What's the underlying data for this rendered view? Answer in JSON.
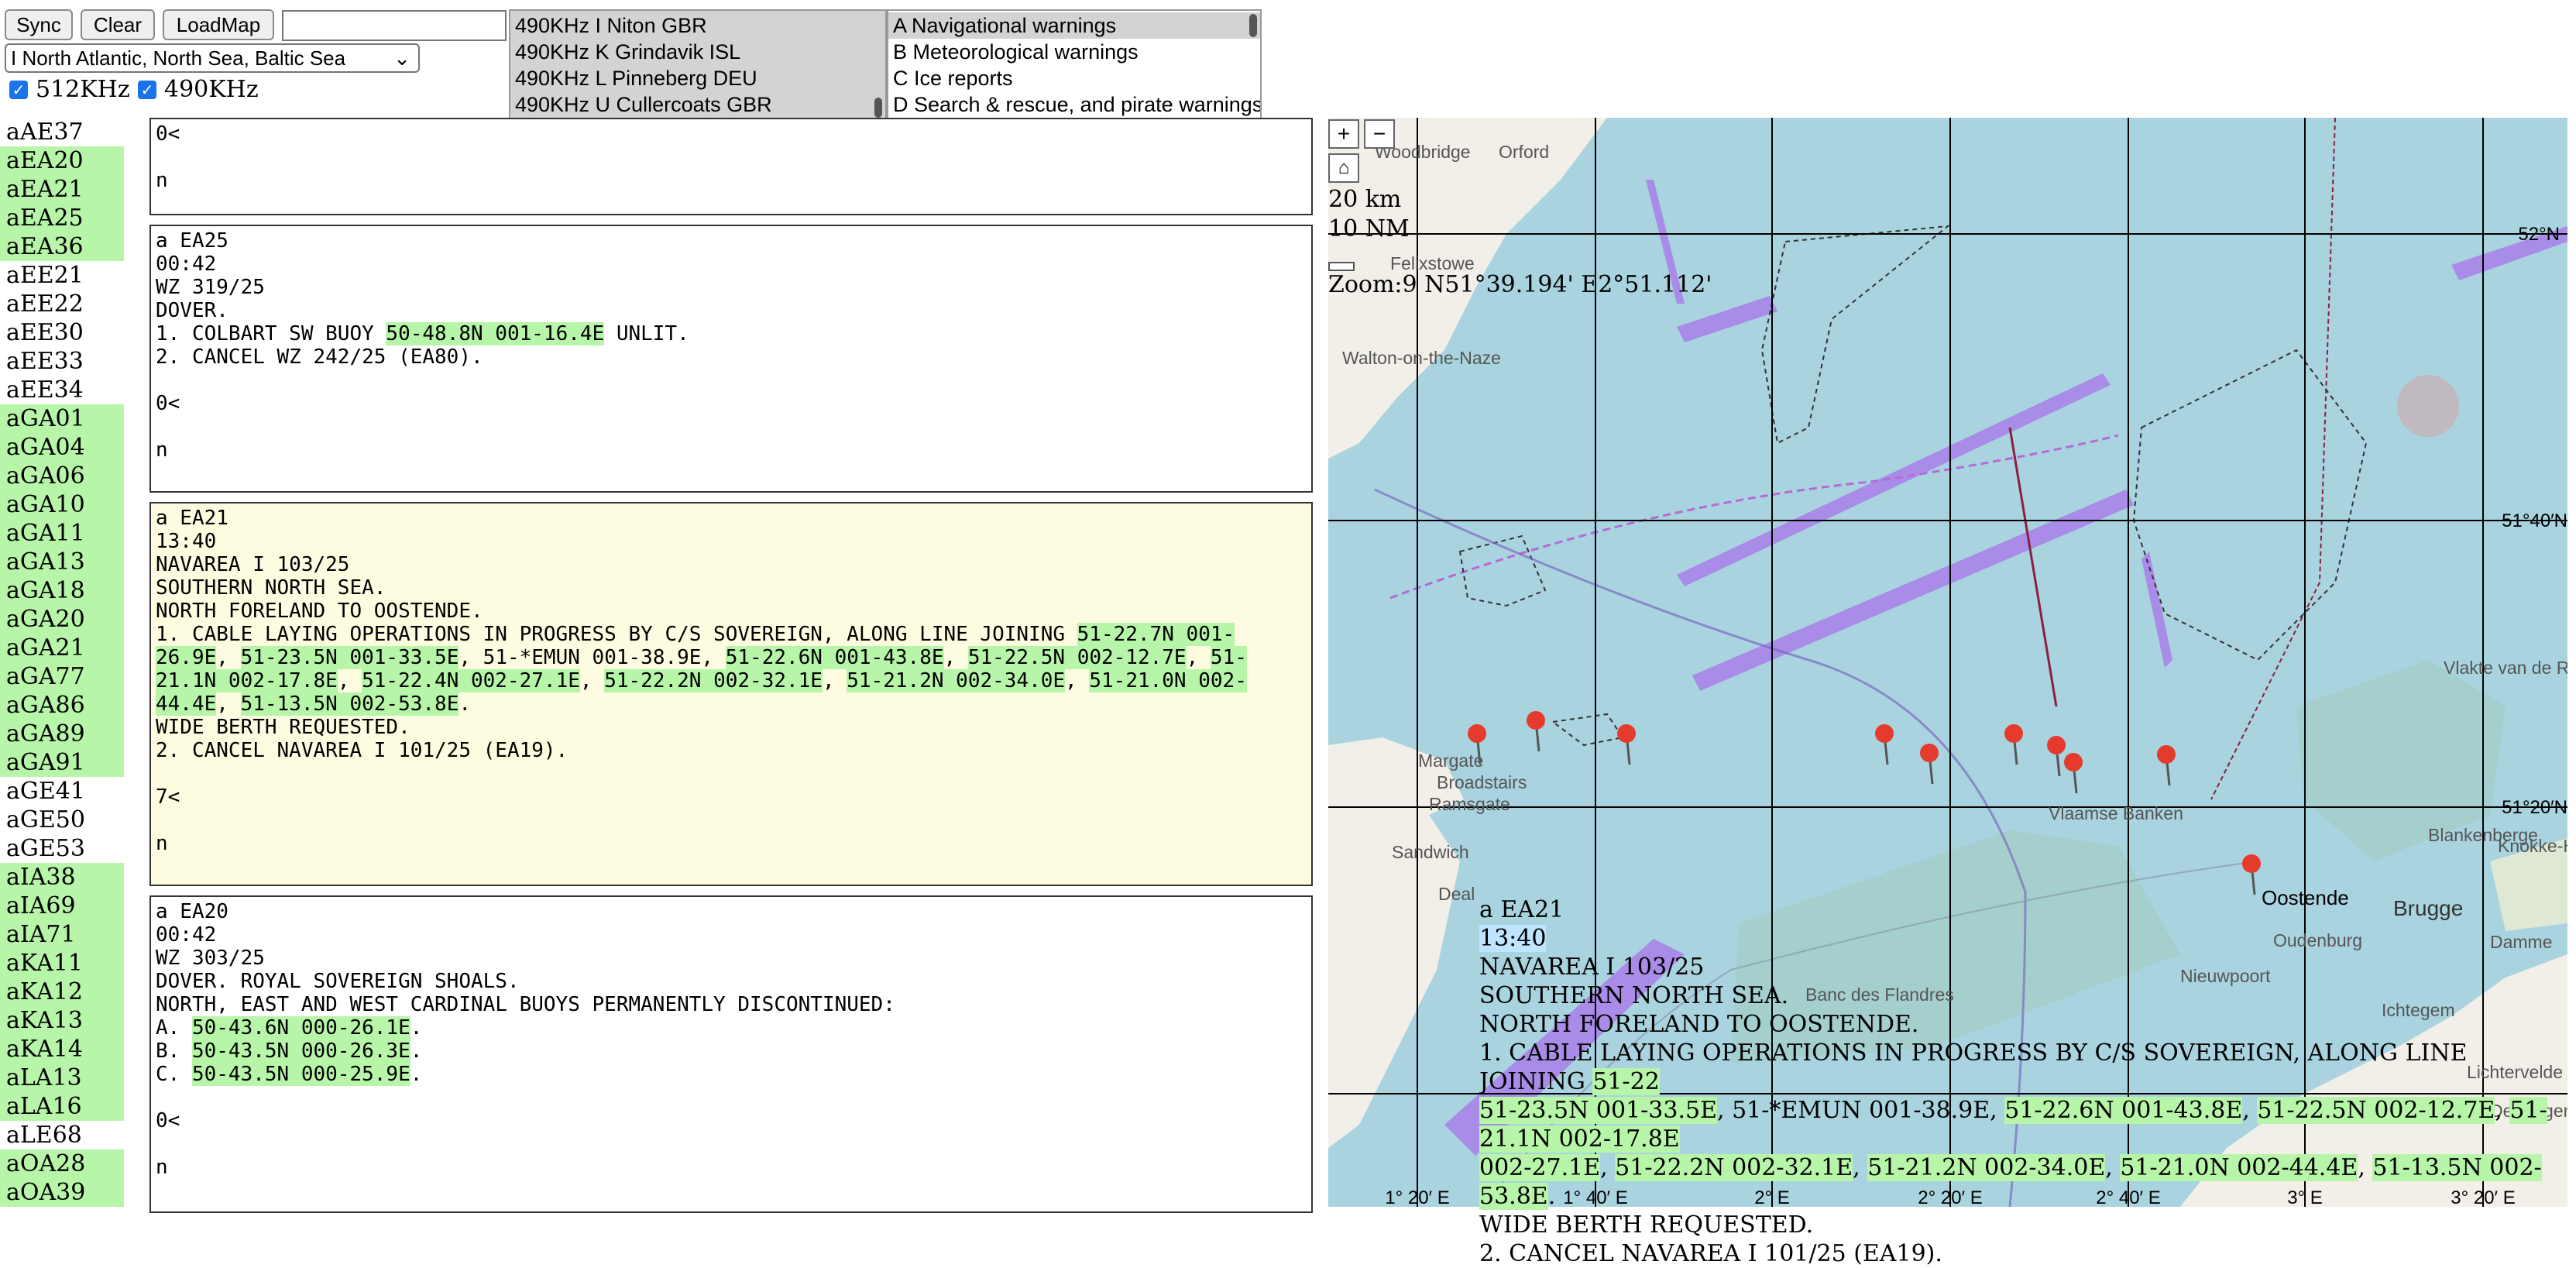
{
  "toolbar": {
    "sync_label": "Sync",
    "clear_label": "Clear",
    "loadmap_label": "LoadMap",
    "search_value": "",
    "region_selected": "I North Atlantic, North Sea, Baltic Sea",
    "chk_512_label": "512KHz",
    "chk_490_label": "490KHz"
  },
  "stations": [
    "490KHz I Niton GBR",
    "490KHz K Grindavik ISL",
    "490KHz L Pinneberg DEU",
    "490KHz U Cullercoats GBR"
  ],
  "categories": [
    "A Navigational warnings",
    "B Meteorological warnings",
    "C Ice reports",
    "D Search & rescue, and pirate warnings"
  ],
  "sidebar": [
    {
      "id": "aAE37",
      "hl": false
    },
    {
      "id": "aEA20",
      "hl": true
    },
    {
      "id": "aEA21",
      "hl": true
    },
    {
      "id": "aEA25",
      "hl": true
    },
    {
      "id": "aEA36",
      "hl": true
    },
    {
      "id": "aEE21",
      "hl": false
    },
    {
      "id": "aEE22",
      "hl": false
    },
    {
      "id": "aEE30",
      "hl": false
    },
    {
      "id": "aEE33",
      "hl": false
    },
    {
      "id": "aEE34",
      "hl": false
    },
    {
      "id": "aGA01",
      "hl": true
    },
    {
      "id": "aGA04",
      "hl": true
    },
    {
      "id": "aGA06",
      "hl": true
    },
    {
      "id": "aGA10",
      "hl": true
    },
    {
      "id": "aGA11",
      "hl": true
    },
    {
      "id": "aGA13",
      "hl": true
    },
    {
      "id": "aGA18",
      "hl": true
    },
    {
      "id": "aGA20",
      "hl": true
    },
    {
      "id": "aGA21",
      "hl": true
    },
    {
      "id": "aGA77",
      "hl": true
    },
    {
      "id": "aGA86",
      "hl": true
    },
    {
      "id": "aGA89",
      "hl": true
    },
    {
      "id": "aGA91",
      "hl": true
    },
    {
      "id": "aGE41",
      "hl": false
    },
    {
      "id": "aGE50",
      "hl": false
    },
    {
      "id": "aGE53",
      "hl": false
    },
    {
      "id": "aIA38",
      "hl": true
    },
    {
      "id": "aIA69",
      "hl": true
    },
    {
      "id": "aIA71",
      "hl": true
    },
    {
      "id": "aKA11",
      "hl": true
    },
    {
      "id": "aKA12",
      "hl": true
    },
    {
      "id": "aKA13",
      "hl": true
    },
    {
      "id": "aKA14",
      "hl": true
    },
    {
      "id": "aLA13",
      "hl": true
    },
    {
      "id": "aLA16",
      "hl": true
    },
    {
      "id": "aLE68",
      "hl": false
    },
    {
      "id": "aOA28",
      "hl": true
    },
    {
      "id": "aOA39",
      "hl": true
    }
  ],
  "messages": [
    {
      "bg": "#ffffff",
      "segments": [
        [
          "0<\n\nn",
          false
        ]
      ]
    },
    {
      "bg": "#ffffff",
      "segments": [
        [
          "a EA25\n00:42\nWZ 319/25\nDOVER.\n1. COLBART SW BUOY ",
          false
        ],
        [
          "50-48.8N 001-16.4E",
          true
        ],
        [
          " UNLIT.\n2. CANCEL WZ 242/25 (EA80).\n\n0<\n\nn",
          false
        ]
      ]
    },
    {
      "bg": "#fefce0",
      "segments": [
        [
          "a EA21\n13:40\nNAVAREA I 103/25\nSOUTHERN NORTH SEA.\nNORTH FORELAND TO OOSTENDE.\n1. CABLE LAYING OPERATIONS IN PROGRESS BY C/S SOVEREIGN, ALONG LINE JOINING ",
          false
        ],
        [
          "51-22.7N 001-26.9E",
          true
        ],
        [
          ", ",
          false
        ],
        [
          "51-23.5N 001-33.5E",
          true
        ],
        [
          ", 51-*EMUN 001-38.9E, ",
          false
        ],
        [
          "51-22.6N 001-43.8E",
          true
        ],
        [
          ", ",
          false
        ],
        [
          "51-22.5N 002-12.7E",
          true
        ],
        [
          ", ",
          false
        ],
        [
          "51-21.1N 002-17.8E",
          true
        ],
        [
          ", ",
          false
        ],
        [
          "51-22.4N 002-27.1E",
          true
        ],
        [
          ", ",
          false
        ],
        [
          "51-22.2N 002-32.1E",
          true
        ],
        [
          ", ",
          false
        ],
        [
          "51-21.2N 002-34.0E",
          true
        ],
        [
          ", ",
          false
        ],
        [
          "51-21.0N 002-44.4E",
          true
        ],
        [
          ", ",
          false
        ],
        [
          "51-13.5N 002-53.8E",
          true
        ],
        [
          ".\nWIDE BERTH REQUESTED.\n2. CANCEL NAVAREA I 101/25 (EA19).\n\n7<\n\nn",
          false
        ]
      ]
    },
    {
      "bg": "#ffffff",
      "segments": [
        [
          "a EA20\n00:42\nWZ 303/25\nDOVER. ROYAL SOVEREIGN SHOALS.\nNORTH, EAST AND WEST CARDINAL BUOYS PERMANENTLY DISCONTINUED:\nA. ",
          false
        ],
        [
          "50-43.6N 000-26.1E",
          true
        ],
        [
          ".\nB. ",
          false
        ],
        [
          "50-43.5N 000-26.3E",
          true
        ],
        [
          ".\nC. ",
          false
        ],
        [
          "50-43.5N 000-25.9E",
          true
        ],
        [
          ".\n\n0<\n\nn",
          false
        ]
      ]
    }
  ],
  "map": {
    "zoom_in": "+",
    "zoom_out": "−",
    "home_icon": "home-icon",
    "scale_km": "20 km",
    "scale_nm": "10 NM",
    "status": "Zoom:9 N51°39.194' E2°51.112'",
    "lat_labels": [
      "52°N",
      "51°40′N",
      "51°20′N"
    ],
    "lon_labels": [
      "1° 20′ E",
      "1° 40′ E",
      "2° E",
      "2° 20′ E",
      "2° 40′ E",
      "3° E",
      "3° 20′ E"
    ],
    "places": [
      "Woodbridge",
      "Orford",
      "Felixstowe",
      "Walton-on-the-Naze",
      "Margate",
      "Broadstairs",
      "Ramsgate",
      "Sandwich",
      "Deal",
      "Vlaamse Banken",
      "Banc des Flandres",
      "Vlakte van de Raan",
      "Blankenberge",
      "Oostende",
      "Brugge",
      "Oudenburg",
      "Nieuwpoort",
      "Damme",
      "Knokke-Heist",
      "Dentergem",
      "Ichtegem",
      "Lichtervelde"
    ],
    "popup": [
      [
        "a EA21\n",
        false,
        false
      ],
      [
        "13:40",
        false,
        true
      ],
      [
        "\nNAVAREA I 103/25\nSOUTHERN NORTH SEA.\nNORTH FORELAND TO OOSTENDE.\n1. CABLE LAYING OPERATIONS IN PROGRESS BY C/S SOVEREIGN, ALONG LINE JOINING ",
        false,
        false
      ],
      [
        "51-22",
        true,
        false
      ],
      [
        "\n",
        false,
        false
      ],
      [
        "51-23.5N 001-33.5E",
        true,
        false
      ],
      [
        ", 51-*EMUN 001-38.9E, ",
        false,
        false
      ],
      [
        "51-22.6N 001-43.8E",
        true,
        false
      ],
      [
        ", ",
        false,
        false
      ],
      [
        "51-22.5N 002-12.7E",
        true,
        false
      ],
      [
        ", ",
        false,
        false
      ],
      [
        "51-21.1N 002-17.8E",
        true,
        false
      ],
      [
        "\n",
        false,
        false
      ],
      [
        "002-27.1E",
        true,
        false
      ],
      [
        ", ",
        false,
        false
      ],
      [
        "51-22.2N 002-32.1E",
        true,
        false
      ],
      [
        ", ",
        false,
        false
      ],
      [
        "51-21.2N 002-34.0E",
        true,
        false
      ],
      [
        ", ",
        false,
        false
      ],
      [
        "51-21.0N 002-44.4E",
        true,
        false
      ],
      [
        ", ",
        false,
        false
      ],
      [
        "51-13.5N 002-53.8E",
        true,
        false
      ],
      [
        ".\nWIDE BERTH REQUESTED.\n2. CANCEL NAVAREA I 101/25 (EA19).",
        false,
        false
      ]
    ],
    "colors": {
      "sea": "#a9d3df",
      "land": "#f2efe9",
      "lane": "#a98be8",
      "zone": "#9ec9b8",
      "grid": "#000000",
      "pin": "#e53b2c",
      "highlight": "#b7f5a8"
    }
  }
}
